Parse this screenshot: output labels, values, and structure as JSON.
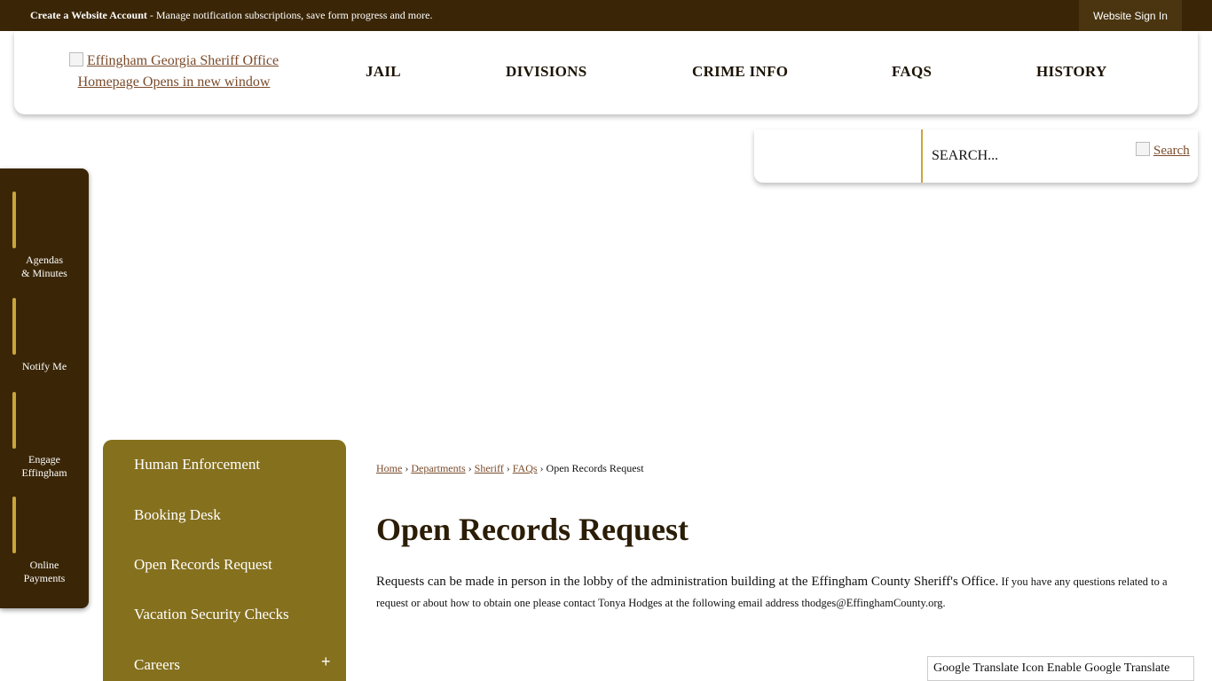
{
  "topbar": {
    "account_bold": "Create a Website Account",
    "account_rest": " - Manage notification subscriptions, save form progress and more.",
    "signin_label": "Website Sign In"
  },
  "header": {
    "logo_alt": "Effingham Georgia Sheriff Office Homepage Opens in new window",
    "nav": [
      {
        "label": "JAIL"
      },
      {
        "label": "DIVISIONS"
      },
      {
        "label": "CRIME INFO"
      },
      {
        "label": "FAQS"
      },
      {
        "label": "HISTORY"
      }
    ]
  },
  "search": {
    "placeholder": "SEARCH...",
    "button_alt": "Search"
  },
  "quick_links": [
    {
      "label": "Agendas\n& Minutes"
    },
    {
      "label": "Notify Me"
    },
    {
      "label": "Engage\nEffingham"
    },
    {
      "label": "Online\nPayments"
    }
  ],
  "side_menu": [
    {
      "label": "Human Enforcement"
    },
    {
      "label": "Booking Desk"
    },
    {
      "label": "Open Records Request"
    },
    {
      "label": "Vacation Security Checks"
    },
    {
      "label": "Careers",
      "expand": "+"
    }
  ],
  "breadcrumb": {
    "items": [
      "Home",
      "Departments",
      "Sheriff",
      "FAQs"
    ],
    "current": "Open Records Request",
    "separator": "›"
  },
  "page": {
    "title": "Open Records Request",
    "body_large": "Requests can be made in person in the lobby of the administration building at the Effingham County Sheriff's Office.",
    "body_small": " If you have any questions related to a request or about how to obtain one please contact Tonya Hodges at the following email address thodges@EffinghamCounty.org."
  },
  "translate": {
    "label": "Google Translate Icon Enable Google Translate"
  }
}
